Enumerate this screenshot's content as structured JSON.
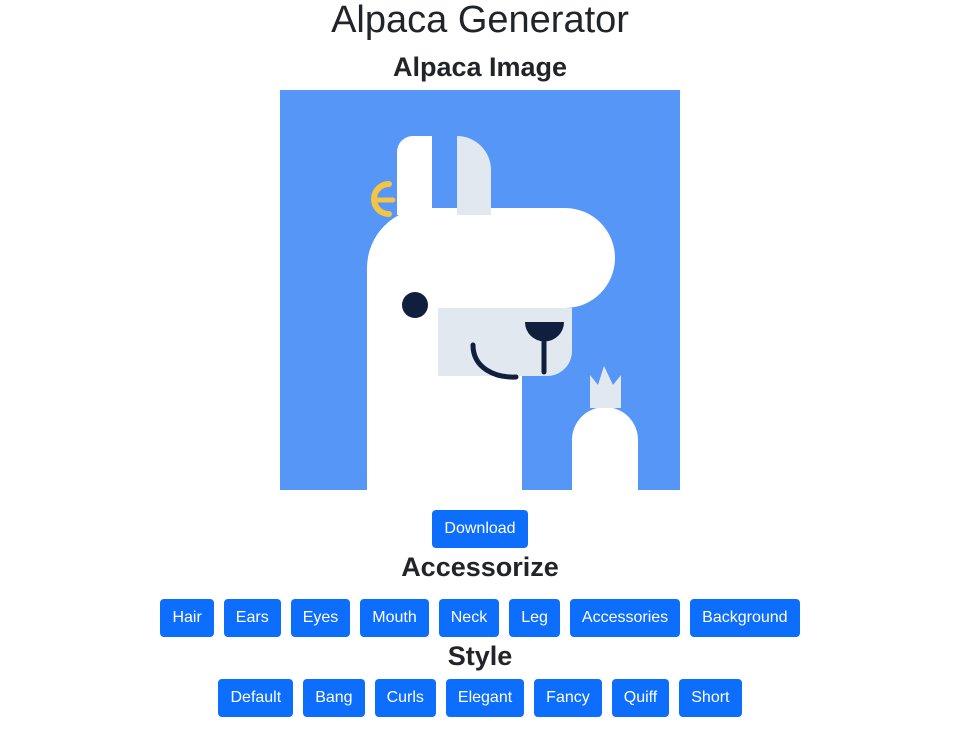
{
  "page": {
    "title": "Alpaca Generator",
    "image_heading": "Alpaca Image",
    "accessorize_heading": "Accessorize",
    "style_heading": "Style"
  },
  "download_label": "Download",
  "accessorize": [
    "Hair",
    "Ears",
    "Eyes",
    "Mouth",
    "Neck",
    "Leg",
    "Accessories",
    "Background"
  ],
  "styles": [
    "Default",
    "Bang",
    "Curls",
    "Elegant",
    "Fancy",
    "Quiff",
    "Short"
  ],
  "colors": {
    "button": "#0d6efd",
    "background": "#5596f6",
    "alpaca_body": "#ffffff",
    "alpaca_muzzle": "#e2e8f0",
    "eye_nose": "#0f1f3d",
    "earring": "#f6c443"
  }
}
